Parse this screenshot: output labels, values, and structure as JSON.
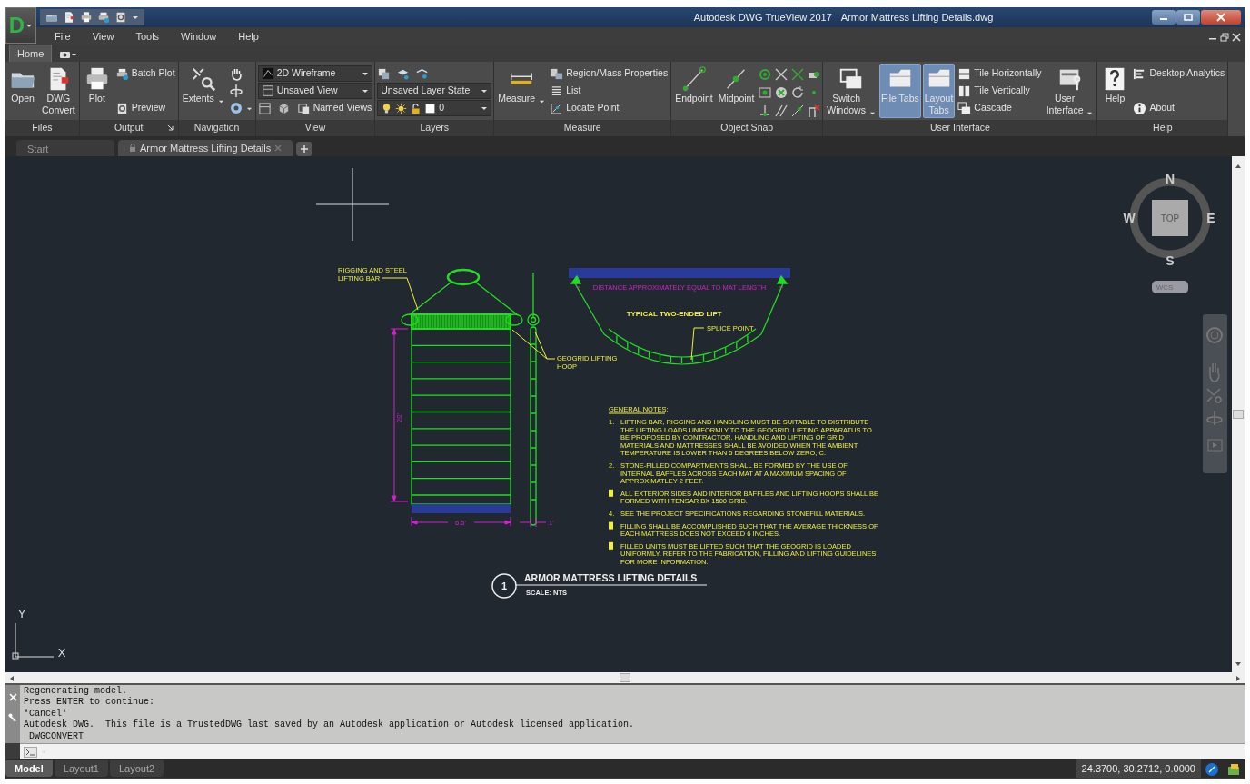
{
  "app": {
    "logo": "D",
    "title": "Autodesk DWG TrueView 2017",
    "document": "Armor Mattress Lifting Details.dwg"
  },
  "menu": [
    "File",
    "View",
    "Tools",
    "Window",
    "Help"
  ],
  "ribbon_tabs": [
    {
      "label": "Home",
      "selected": true
    }
  ],
  "panels": [
    {
      "title": "Files",
      "launcher": false,
      "groups": [
        {
          "kind": "large",
          "label": "Open",
          "menu": false,
          "selected": false
        },
        {
          "kind": "large",
          "label": "DWG\nConvert",
          "menu": false,
          "selected": false
        }
      ]
    },
    {
      "title": "Output",
      "launcher": true,
      "groups": [
        {
          "kind": "large",
          "label": "Plot",
          "menu": false,
          "selected": false
        },
        {
          "kind": "stack",
          "items": [
            {
              "kind": "tool",
              "label": "Batch Plot",
              "menu": false
            },
            {
              "kind": "tool",
              "label": "Preview",
              "menu": false
            }
          ]
        }
      ]
    },
    {
      "title": "Navigation",
      "launcher": false,
      "groups": [
        {
          "kind": "large",
          "label": "Extents",
          "menu": true,
          "selected": false
        },
        {
          "kind": "stack",
          "items": [
            {
              "kind": "tool",
              "menu": false
            },
            {
              "kind": "tool",
              "menu": false
            },
            {
              "kind": "tool",
              "menu": true
            }
          ]
        }
      ]
    },
    {
      "title": "View",
      "launcher": false,
      "groups": [
        {
          "kind": "stack",
          "items": [
            {
              "kind": "combo",
              "value": "2D Wireframe"
            },
            {
              "kind": "combo",
              "value": "Unsaved View"
            },
            {
              "kind": "row",
              "tools": [
                {
                  "kind": "icon"
                },
                {
                  "kind": "icon"
                },
                {
                  "kind": "labeled",
                  "label": "Named Views"
                }
              ]
            }
          ]
        }
      ]
    },
    {
      "title": "Layers",
      "launcher": false,
      "groups": [
        {
          "kind": "stack",
          "items": [
            {
              "kind": "row",
              "tools": [
                {
                  "kind": "icon"
                },
                {
                  "kind": "icon"
                },
                {
                  "kind": "icon"
                }
              ]
            },
            {
              "kind": "combo",
              "value": "Unsaved Layer State"
            },
            {
              "kind": "layer-combo",
              "value": "0"
            }
          ]
        }
      ]
    },
    {
      "title": "Measure",
      "launcher": false,
      "groups": [
        {
          "kind": "large",
          "label": "Measure",
          "menu": true,
          "selected": false
        },
        {
          "kind": "stack",
          "items": [
            {
              "kind": "tool",
              "label": "Region/Mass Properties",
              "menu": false
            },
            {
              "kind": "tool",
              "label": "List",
              "menu": false
            },
            {
              "kind": "tool",
              "label": "Locate Point",
              "menu": false
            }
          ]
        }
      ]
    },
    {
      "title": "Object Snap",
      "launcher": false,
      "groups": [
        {
          "kind": "large",
          "label": "Endpoint",
          "menu": false,
          "selected": false
        },
        {
          "kind": "large",
          "label": "Midpoint",
          "menu": false,
          "selected": false
        },
        {
          "kind": "snap-grid"
        }
      ]
    },
    {
      "title": "User Interface",
      "launcher": false,
      "groups": [
        {
          "kind": "large",
          "label": "Switch\nWindows",
          "menu": true,
          "selected": false
        },
        {
          "kind": "large",
          "label": "File Tabs",
          "menu": false,
          "selected": true
        },
        {
          "kind": "large",
          "label": "Layout\nTabs",
          "menu": false,
          "selected": true
        },
        {
          "kind": "stack",
          "items": [
            {
              "kind": "tool",
              "label": "Tile Horizontally",
              "menu": false
            },
            {
              "kind": "tool",
              "label": "Tile Vertically",
              "menu": false
            },
            {
              "kind": "tool",
              "label": "Cascade",
              "menu": false
            }
          ]
        },
        {
          "kind": "large",
          "label": "User\nInterface",
          "menu": true,
          "selected": false
        }
      ]
    },
    {
      "title": "Help",
      "launcher": false,
      "groups": [
        {
          "kind": "large",
          "label": "Help",
          "menu": false,
          "selected": false
        },
        {
          "kind": "stack",
          "items": [
            {
              "kind": "tool",
              "label": "Desktop Analytics",
              "menu": false
            },
            {
              "kind": "tool",
              "label": "About",
              "menu": false
            }
          ]
        }
      ]
    }
  ],
  "file_tabs": [
    {
      "label": "Start",
      "selected": false
    },
    {
      "label": "Armor Mattress Lifting Details",
      "selected": true
    }
  ],
  "drawing": {
    "rigging_label": [
      "RIGGING AND STEEL",
      "LIFTING BAR"
    ],
    "hoop_label": [
      "GEOGRID LIFTING",
      "HOOP"
    ],
    "height_dim": "20'",
    "width_dim": "6.5'",
    "depth_dim": "1'",
    "distance_label": "DISTANCE APPROXIMATELY EQUAL TO MAT LENGTH",
    "lift_title": "TYPICAL TWO-ENDED LIFT",
    "splice_label": "SPLICE POINT",
    "notes_heading": "GENERAL NOTES:",
    "notes": [
      {
        "kind": "numbered",
        "number": "1.",
        "lines": [
          "LIFTING BAR, RIGGING AND HANDLING MUST BE SUITABLE TO DISTRIBUTE",
          "THE LIFTING LOADS UNIFORMLY TO THE GEOGRID. LIFTING APPARATUS TO",
          "BE PROPOSED BY CONTRACTOR. HANDLING AND LIFTING OF GRID",
          "MATERIALS AND MATTRESSES SHALL BE AVOIDED WHEN THE AMBIENT",
          "TEMPERATURE IS LOWER THAN 5 DEGREES BELOW ZERO, C."
        ]
      },
      {
        "kind": "numbered",
        "number": "2.",
        "lines": [
          "STONE-FILLED COMPARTMENTS SHALL BE FORMED BY THE USE OF",
          "INTERNAL BAFFLES ACROSS EACH MAT AT A MAXIMUM SPACING OF",
          "APPROXIMATLEY 2 FEET."
        ]
      },
      {
        "kind": "block",
        "lines": [
          "ALL EXTERIOR SIDES AND INTERIOR BAFFLES AND LIFTING HOOPS SHALL BE",
          "FORMED WITH TENSAR BX 1500 GRID."
        ]
      },
      {
        "kind": "numbered",
        "number": "4.",
        "lines": [
          "SEE THE PROJECT SPECIFICATIONS REGARDING STONEFILL MATERIALS."
        ]
      },
      {
        "kind": "block",
        "lines": [
          "FILLING SHALL BE ACCOMPLISHED SUCH THAT THE AVERAGE THICKNESS OF",
          "EACH MATTRESS DOES NOT EXCEED 6 INCHES."
        ]
      },
      {
        "kind": "block",
        "lines": [
          "FILLED UNITS MUST BE LIFTED SUCH THAT THE GEOGRID IS LOADED",
          "UNIFORMLY. REFER TO THE FABRICATION, FILLING AND LIFTING GUIDELINES",
          "FOR MORE INFORMATION."
        ]
      }
    ],
    "detail_number": "1",
    "detail_title": "ARMOR MATTRESS LIFTING DETAILS",
    "detail_scale": "SCALE: NTS"
  },
  "viewcube": {
    "north": "N",
    "west": "W",
    "east": "E",
    "south": "S",
    "face": "TOP",
    "ucs": "WCS"
  },
  "axes": {
    "y": "Y",
    "x": "X"
  },
  "command_history": [
    "Regenerating model.",
    "Press ENTER to continue:",
    "*Cancel*",
    "Autodesk DWG.  This file is a TrustedDWG last saved by an Autodesk application or Autodesk licensed application.",
    "_DWGCONVERT"
  ],
  "layout_tabs": [
    {
      "label": "Model",
      "selected": true
    },
    {
      "label": "Layout1",
      "selected": false
    },
    {
      "label": "Layout2",
      "selected": false
    }
  ],
  "coordinates": "24.3700, 30.2712, 0.0000"
}
